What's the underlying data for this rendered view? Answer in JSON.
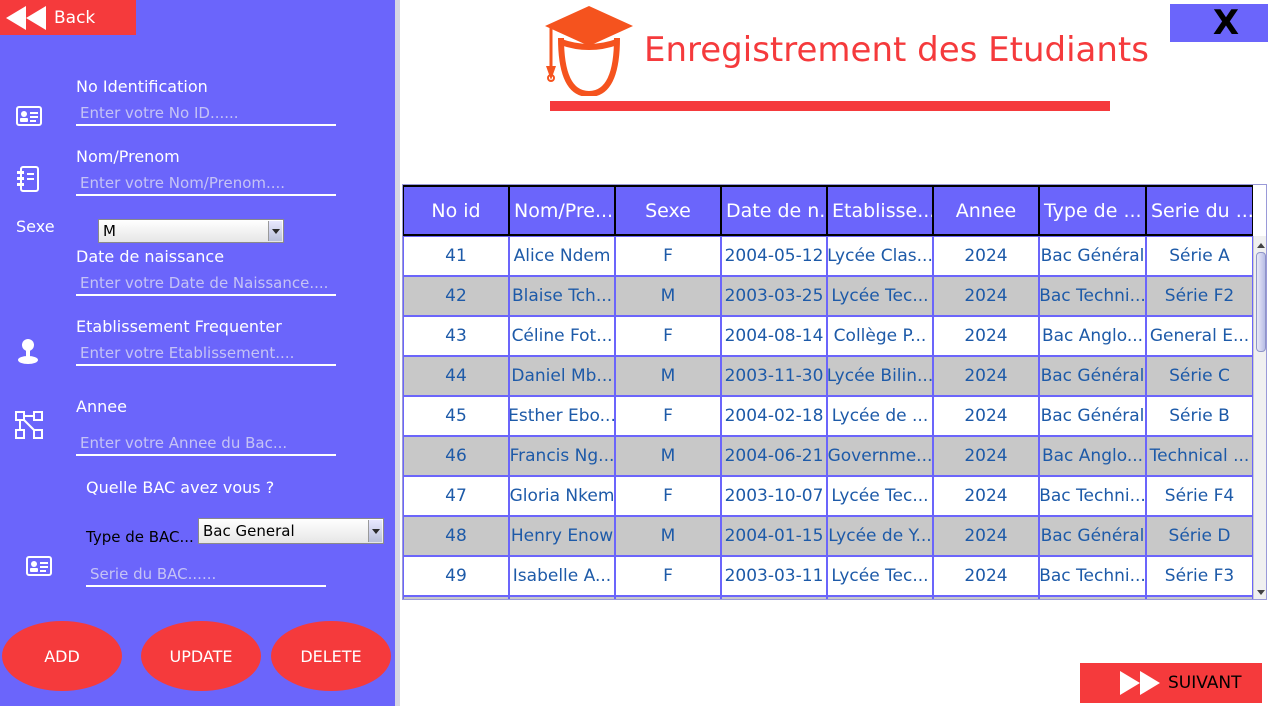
{
  "nav": {
    "back_label": "Back",
    "close_label": "X",
    "next_label": "SUIVANT"
  },
  "page": {
    "title": "Enregistrement des Etudiants"
  },
  "form": {
    "id_label": "No Identification",
    "id_placeholder": "Enter votre No ID......",
    "name_label": "Nom/Prenom",
    "name_placeholder": "Enter votre Nom/Prenom....",
    "sexe_label": "Sexe",
    "sexe_value": "M",
    "birth_label": "Date de naissance",
    "birth_placeholder": "Enter votre Date de Naissance....",
    "school_label": "Etablissement Frequenter",
    "school_placeholder": "Enter votre Etablissement....",
    "year_label": "Annee",
    "year_placeholder": "Enter votre Annee du Bac...",
    "bac_question": "Quelle BAC avez vous ?",
    "bac_type_label": "Type de BAC...",
    "bac_type_value": "Bac General",
    "serie_placeholder": "Serie du BAC......"
  },
  "actions": {
    "add": "ADD",
    "update": "UPDATE",
    "delete": "DELETE"
  },
  "table": {
    "columns": [
      "No id",
      "Nom/Pre...",
      "Sexe",
      "Date de n...",
      "Etablisse...",
      "Annee",
      "Type de ...",
      "Serie du ..."
    ],
    "rows": [
      [
        "41",
        "Alice Ndem",
        "F",
        "2004-05-12",
        "Lycée Clas...",
        "2024",
        "Bac Général",
        "Série A"
      ],
      [
        "42",
        "Blaise Tch...",
        "M",
        "2003-03-25",
        "Lycée Tec...",
        "2024",
        "Bac Techni...",
        "Série F2"
      ],
      [
        "43",
        "Céline Fot...",
        "F",
        "2004-08-14",
        "Collège P...",
        "2024",
        "Bac Anglo...",
        "General E..."
      ],
      [
        "44",
        "Daniel Mb...",
        "M",
        "2003-11-30",
        "Lycée Bilin...",
        "2024",
        "Bac Général",
        "Série C"
      ],
      [
        "45",
        "Esther Ebo...",
        "F",
        "2004-02-18",
        "Lycée de ...",
        "2024",
        "Bac Général",
        "Série B"
      ],
      [
        "46",
        "Francis Ng...",
        "M",
        "2004-06-21",
        "Governme...",
        "2024",
        "Bac Anglo...",
        "Technical ..."
      ],
      [
        "47",
        "Gloria Nkem",
        "F",
        "2003-10-07",
        "Lycée Tec...",
        "2024",
        "Bac Techni...",
        "Série F4"
      ],
      [
        "48",
        "Henry Enow",
        "M",
        "2004-01-15",
        "Lycée de Y...",
        "2024",
        "Bac Général",
        "Série D"
      ],
      [
        "49",
        "Isabelle A...",
        "F",
        "2003-03-11",
        "Lycée Tec...",
        "2024",
        "Bac Techni...",
        "Série F3"
      ],
      [
        "",
        "",
        "",
        "",
        "",
        "",
        "",
        ""
      ]
    ]
  },
  "colors": {
    "panel": "#6b65fb",
    "accent": "#f53a3c",
    "cell_text": "#1d5aa8",
    "row_alt": "#c8c8c8"
  }
}
